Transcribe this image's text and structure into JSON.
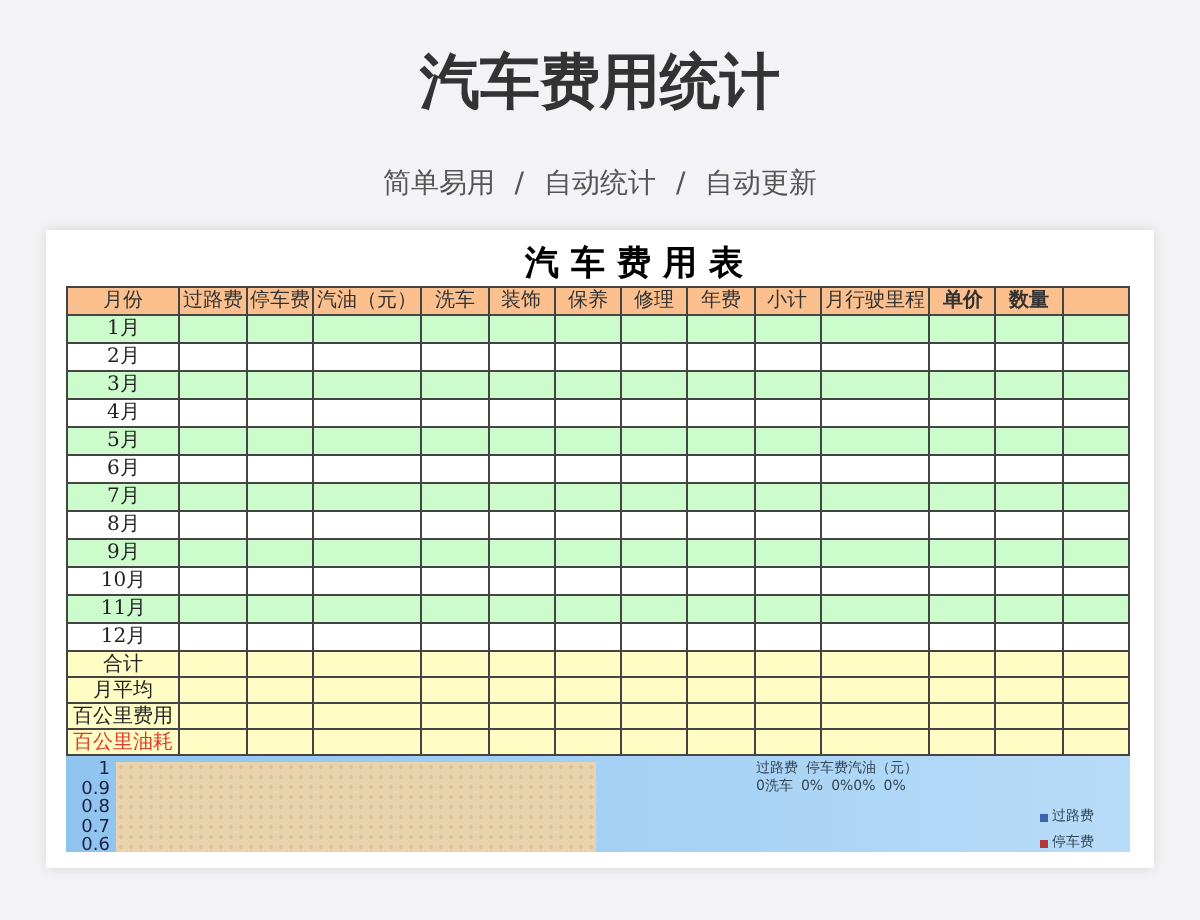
{
  "title": "汽车费用统计",
  "subtitle": [
    "简单易用",
    "/",
    "自动统计",
    "/",
    "自动更新"
  ],
  "sheet": {
    "title": "汽车费用表",
    "columns": [
      {
        "label": "月份",
        "bold": false
      },
      {
        "label": "过路费",
        "bold": false
      },
      {
        "label": "停车费",
        "bold": false
      },
      {
        "label": "汽油（元）",
        "bold": false
      },
      {
        "label": "洗车",
        "bold": false
      },
      {
        "label": "装饰",
        "bold": false
      },
      {
        "label": "保养",
        "bold": false
      },
      {
        "label": "修理",
        "bold": false
      },
      {
        "label": "年费",
        "bold": false
      },
      {
        "label": "小计",
        "bold": false
      },
      {
        "label": "月行驶里程",
        "bold": false
      },
      {
        "label": "单价",
        "bold": true
      },
      {
        "label": "数量",
        "bold": true
      }
    ],
    "months": [
      "1月",
      "2月",
      "3月",
      "4月",
      "5月",
      "6月",
      "7月",
      "8月",
      "9月",
      "10月",
      "11月",
      "12月"
    ],
    "summary_rows": [
      {
        "label": "合计",
        "highlighted": false
      },
      {
        "label": "月平均",
        "highlighted": false
      },
      {
        "label": "百公里费用",
        "highlighted": false
      },
      {
        "label": "百公里油耗",
        "highlighted": true
      }
    ]
  },
  "chart": {
    "y_ticks": [
      "1",
      "0.9",
      "0.8",
      "0.7",
      "0.6"
    ],
    "pie_labels": [
      {
        "text": "过路费"
      },
      {
        "text": "停车费汽油（元）"
      },
      {
        "text": "0洗车"
      },
      {
        "text": "0%"
      },
      {
        "text": "0%0%"
      },
      {
        "text": "0%"
      }
    ],
    "legend": [
      {
        "label": "过路费",
        "color": "#3a63b0"
      },
      {
        "label": "停车费",
        "color": "#b03a3a"
      }
    ]
  }
}
